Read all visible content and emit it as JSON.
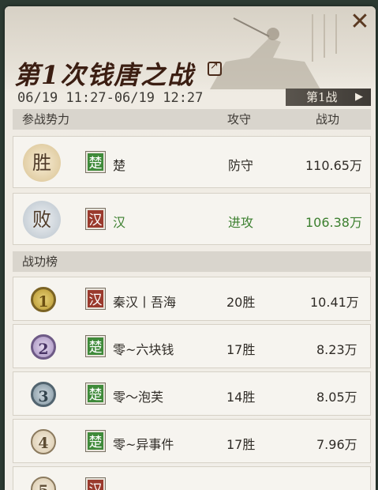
{
  "title": "第1次钱唐之战",
  "time_range": "06/19 11:27-06/19 12:27",
  "battle_button": "第1战",
  "factions_header": {
    "col1": "参战势力",
    "col2": "攻守",
    "col3": "战功"
  },
  "factions": [
    {
      "result": "胜",
      "flag": "楚",
      "name": "楚",
      "role": "防守",
      "merit": "110.65万",
      "highlight": false
    },
    {
      "result": "败",
      "flag": "汉",
      "name": "汉",
      "role": "进攻",
      "merit": "106.38万",
      "highlight": true
    }
  ],
  "ranking_header": "战功榜",
  "ranking": [
    {
      "rank": "1",
      "flag": "汉",
      "name": "秦汉丨吾海",
      "wins": "20胜",
      "merit": "10.41万"
    },
    {
      "rank": "2",
      "flag": "楚",
      "name": "零~六块钱",
      "wins": "17胜",
      "merit": "8.23万"
    },
    {
      "rank": "3",
      "flag": "楚",
      "name": "零～泡芙",
      "wins": "14胜",
      "merit": "8.05万"
    },
    {
      "rank": "4",
      "flag": "楚",
      "name": "零~异事件",
      "wins": "17胜",
      "merit": "7.96万"
    },
    {
      "rank": "5",
      "flag": "汉",
      "name": "",
      "wins": "",
      "merit": ""
    }
  ]
}
